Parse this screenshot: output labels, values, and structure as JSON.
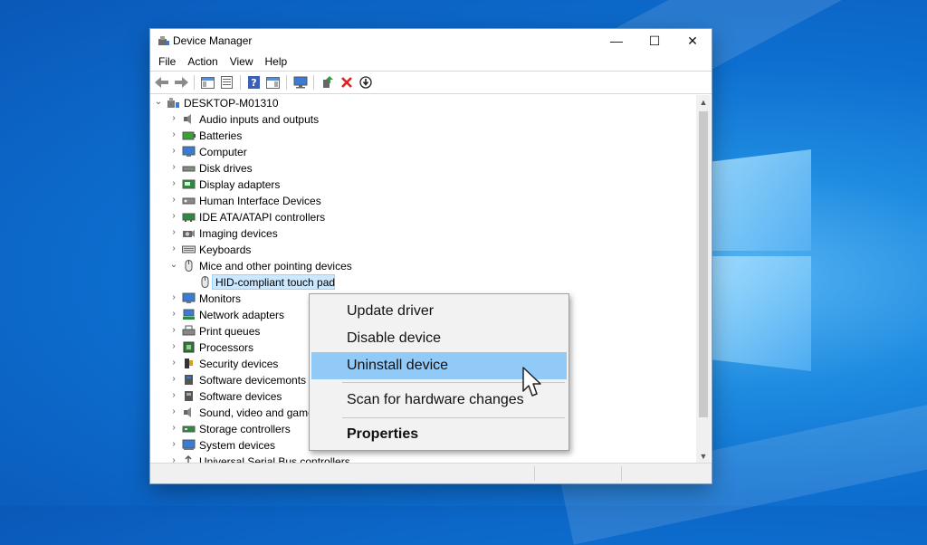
{
  "window": {
    "title": "Device Manager",
    "controls": {
      "minimize": "—",
      "maximize": "☐",
      "close": "✕"
    }
  },
  "menu": [
    "File",
    "Action",
    "View",
    "Help"
  ],
  "toolbar_icons": [
    "back-icon",
    "forward-icon",
    "show-hide-console-tree-icon",
    "properties-sheet-icon",
    "help-icon",
    "action-pane-icon",
    "scan-hardware-icon",
    "update-driver-icon",
    "uninstall-icon",
    "disable-device-icon"
  ],
  "tree": {
    "root": "DESKTOP-M01310",
    "categories": [
      {
        "label": "Audio inputs and outputs",
        "icon": "speaker-icon"
      },
      {
        "label": "Batteries",
        "icon": "battery-icon"
      },
      {
        "label": "Computer",
        "icon": "computer-icon"
      },
      {
        "label": "Disk drives",
        "icon": "disk-drive-icon"
      },
      {
        "label": "Display adapters",
        "icon": "display-adapter-icon"
      },
      {
        "label": "Human Interface Devices",
        "icon": "hid-icon"
      },
      {
        "label": "IDE ATA/ATAPI controllers",
        "icon": "ide-controller-icon"
      },
      {
        "label": "Imaging devices",
        "icon": "camera-icon"
      },
      {
        "label": "Keyboards",
        "icon": "keyboard-icon"
      },
      {
        "label": "Mice and other pointing devices",
        "icon": "mouse-icon",
        "expanded": true,
        "children": [
          {
            "label": "HID-compliant touch pad",
            "icon": "mouse-icon",
            "selected": true
          }
        ]
      },
      {
        "label": "Monitors",
        "icon": "monitor-icon"
      },
      {
        "label": "Network adapters",
        "icon": "network-adapter-icon"
      },
      {
        "label": "Print queues",
        "icon": "printer-icon"
      },
      {
        "label": "Processors",
        "icon": "processor-icon"
      },
      {
        "label": "Security devices",
        "icon": "security-device-icon"
      },
      {
        "label": "Software devicemonts",
        "icon": "software-component-icon"
      },
      {
        "label": "Software devices",
        "icon": "software-device-icon"
      },
      {
        "label": "Sound, video and game controllers",
        "icon": "sound-icon"
      },
      {
        "label": "Storage controllers",
        "icon": "storage-controller-icon"
      },
      {
        "label": "System devices",
        "icon": "system-device-icon"
      },
      {
        "label": "Universal Serial Bus controllers",
        "icon": "usb-icon"
      }
    ]
  },
  "context_menu": {
    "items": [
      "Update driver",
      "Disable device",
      "Uninstall device",
      "Scan for hardware changes",
      "Properties"
    ],
    "highlighted": "Uninstall device"
  },
  "colors": {
    "selection": "#cce8ff",
    "menu_highlight": "#91c9f7",
    "desktop": "#0d6fd0"
  }
}
